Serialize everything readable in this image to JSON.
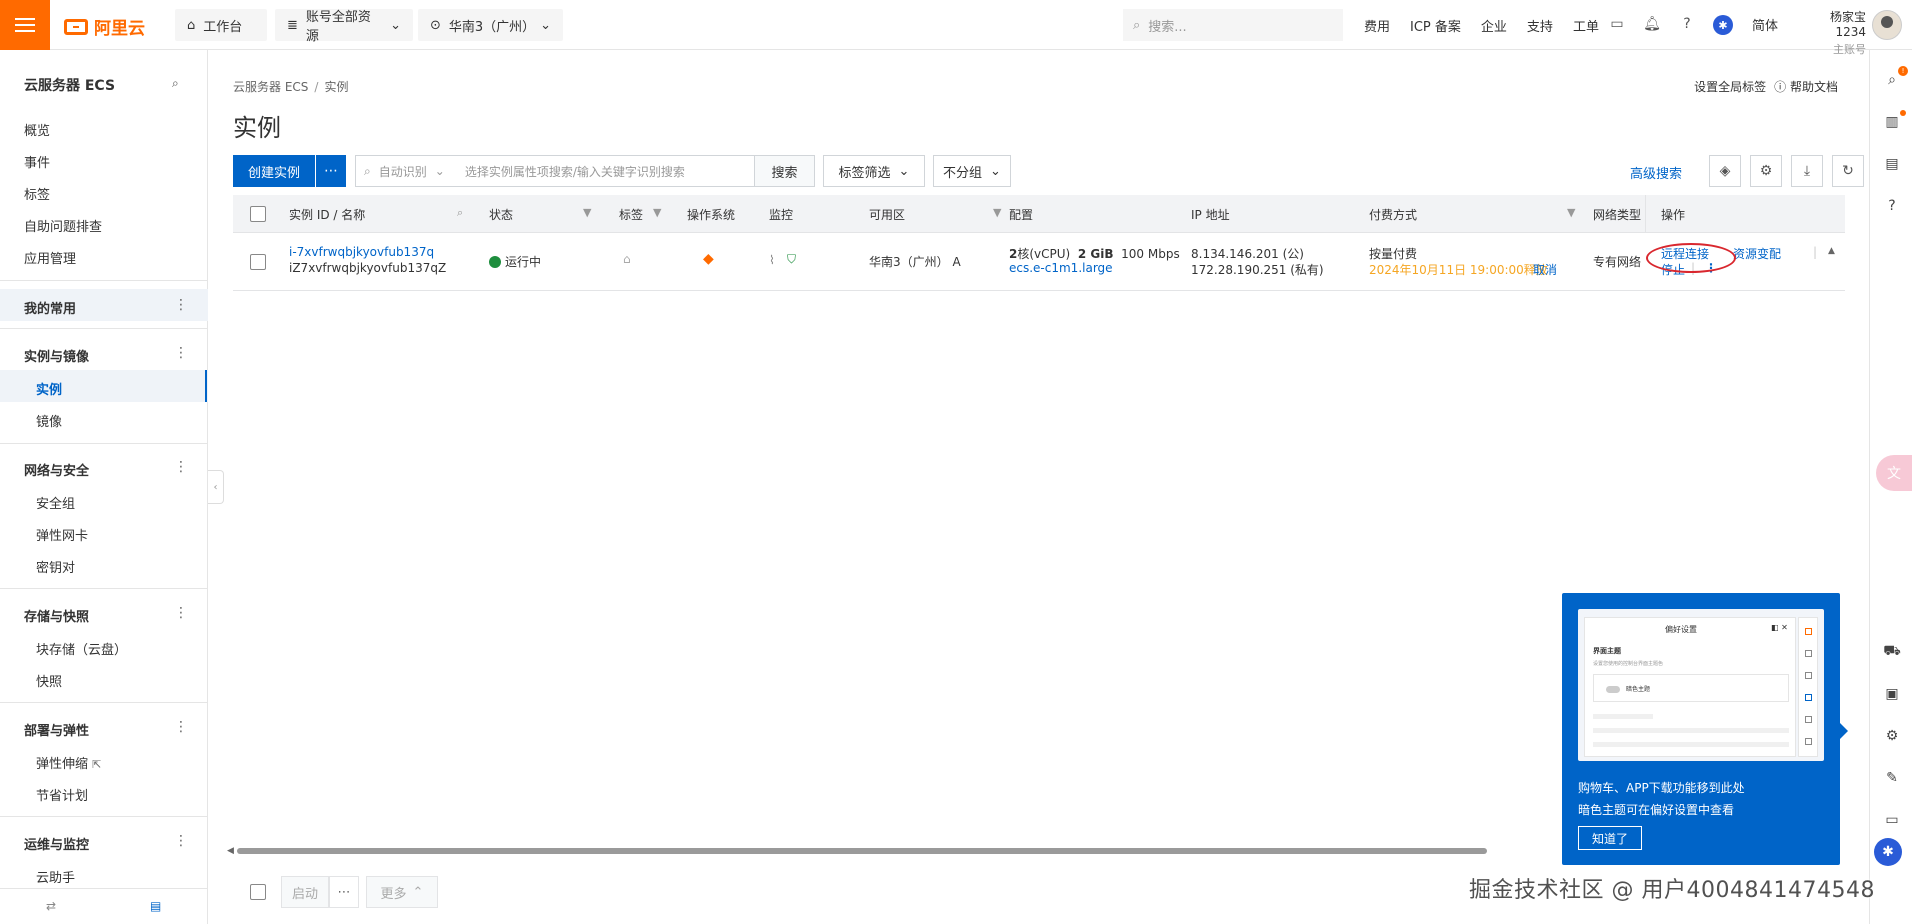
{
  "topbar": {
    "brand": "阿里云",
    "workbench": "工作台",
    "resources": "账号全部资源",
    "region": "华南3（广州）",
    "search_placeholder": "搜索...",
    "links": [
      "费用",
      "ICP 备案",
      "企业",
      "支持",
      "工单"
    ],
    "lang": "简体",
    "user_name": "杨家宝1234",
    "user_role": "主账号",
    "brand_color": "#ff6a00"
  },
  "sidebar": {
    "title": "云服务器 ECS",
    "top_items": [
      "概览",
      "事件",
      "标签",
      "自助问题排查",
      "应用管理"
    ],
    "favorites": "我的常用",
    "groups": [
      {
        "label": "实例与镜像",
        "items": [
          "实例",
          "镜像"
        ]
      },
      {
        "label": "网络与安全",
        "items": [
          "安全组",
          "弹性网卡",
          "密钥对"
        ]
      },
      {
        "label": "存储与快照",
        "items": [
          "块存储（云盘）",
          "快照"
        ]
      },
      {
        "label": "部署与弹性",
        "items": [
          "弹性伸缩",
          "节省计划"
        ]
      },
      {
        "label": "运维与监控",
        "items": [
          "云助手"
        ]
      }
    ],
    "active_item": "实例"
  },
  "main": {
    "breadcrumb": [
      "云服务器 ECS",
      "实例"
    ],
    "title": "实例",
    "global_tags": "设置全局标签",
    "help": "帮助文档",
    "create_btn": "创建实例",
    "auto_detect": "自动识别",
    "search_placeholder": "选择实例属性项搜索/输入关键字识别搜索",
    "search_btn": "搜索",
    "tag_filter": "标签筛选",
    "group": "不分组",
    "adv_search": "高级搜索",
    "accent": "#0064c8"
  },
  "table": {
    "headers": [
      "实例 ID / 名称",
      "状态",
      "标签",
      "操作系统",
      "监控",
      "可用区",
      "配置",
      "IP 地址",
      "付费方式",
      "网络类型",
      "操作"
    ],
    "rows": [
      {
        "id": "i-7xvfrwqbjkyovfub137q",
        "name": "iZ7xvfrwqbjkyovfub137qZ",
        "status": "运行中",
        "zone": "华南3（广州） A",
        "config_prefix": "2",
        "config_cpu": "核(vCPU)",
        "config_mem": "2 GiB",
        "config_bw": "100 Mbps",
        "instance_type": "ecs.e-c1m1.large",
        "public_ip": "8.134.146.201 (公)",
        "private_ip": "172.28.190.251 (私有)",
        "billing": "按量付费",
        "release_time": "2024年10月11日 19:00:00释放",
        "cancel": "取消",
        "network": "专有网络",
        "op_remote": "远程连接",
        "op_change": "资源变配",
        "op_stop": "停止"
      }
    ]
  },
  "bottom": {
    "start": "启动",
    "more": "更多"
  },
  "popup": {
    "shot_title": "偏好设置",
    "shot_label": "界面主题",
    "shot_desc": "设置您使用的控制台界面主题色",
    "shot_toggle": "暗色主题",
    "line1": "购物车、APP下载功能移到此处",
    "line2": "暗色主题可在偏好设置中查看",
    "btn": "知道了"
  },
  "watermark": "掘金技术社区 @ 用户4004841474548"
}
